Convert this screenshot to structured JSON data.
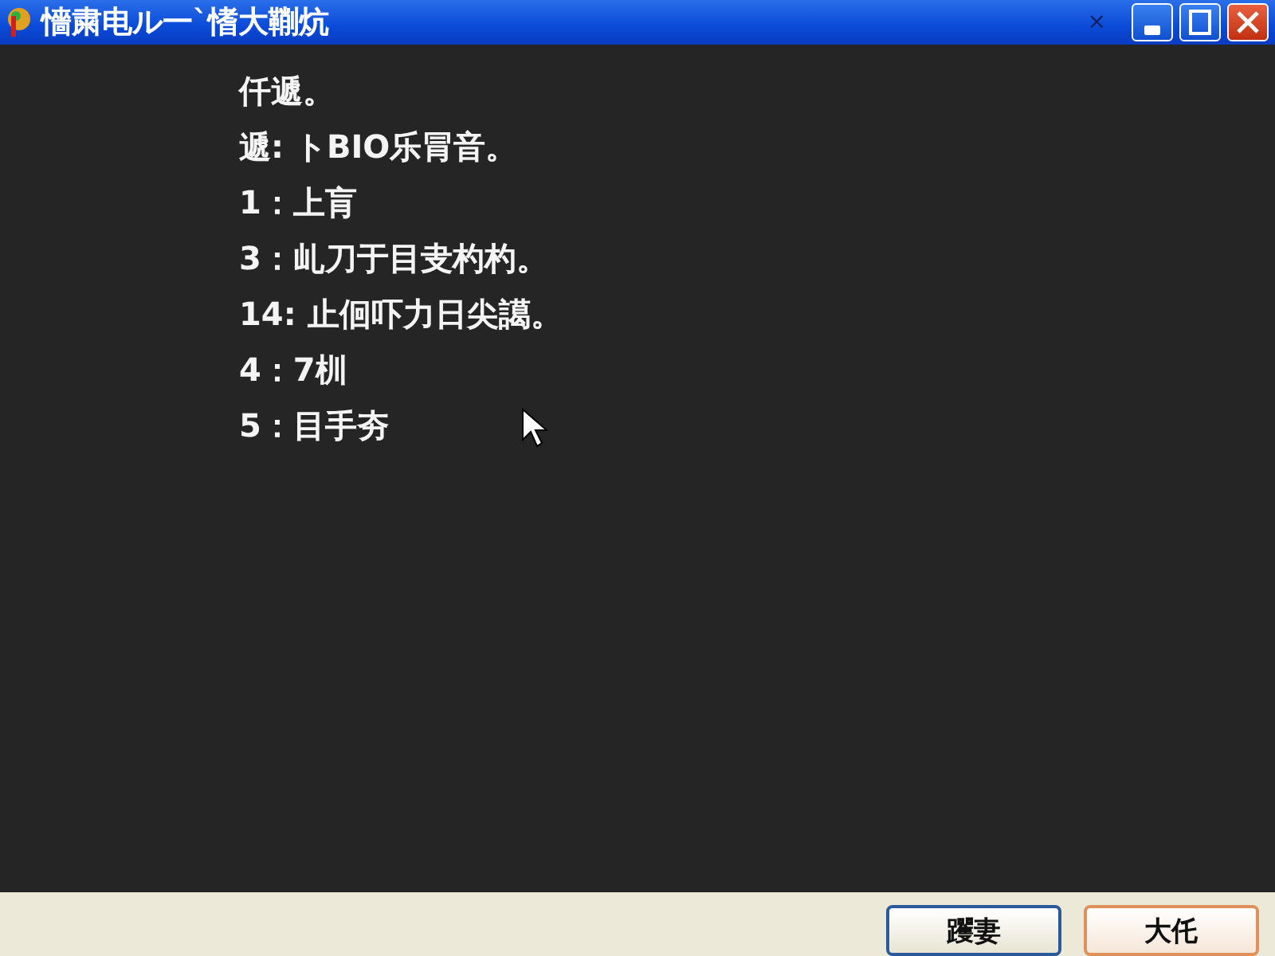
{
  "window": {
    "title": "懎粛电ル一ˋ愭大鞩炕",
    "close_glyph": "×"
  },
  "lines": [
    "仟遞。",
    "遞: トBIO乐冐音。",
    "1：上肓",
    "3：乢刀于目叏杓杓。",
    "14: 止佪吓力日尖譪。",
    "4：7杊",
    "5：目手夯"
  ],
  "buttons": [
    {
      "label": "躩妻",
      "kind": "default"
    },
    {
      "label": "大仛",
      "kind": "cancel"
    }
  ]
}
